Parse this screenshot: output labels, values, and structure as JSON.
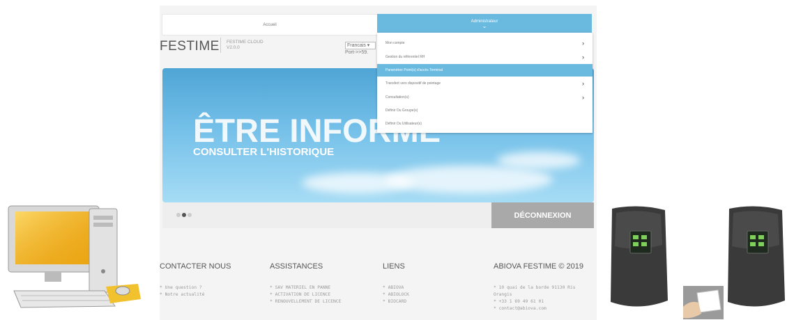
{
  "tabs": {
    "home": "Accueil",
    "admin": "Administrateur"
  },
  "header": {
    "brand": "FESTIME",
    "product_name": "FESTIME CLOUD",
    "product_version": "V2.0.0",
    "language": "Francais ▾",
    "port": "Port->>59."
  },
  "hero": {
    "title": "ÊTRE INFORMÉ",
    "subtitle": "CONSULTER L'HISTORIQUE",
    "slide_count": 3,
    "active_slide": 2
  },
  "logout_label": "DÉCONNEXION",
  "admin_menu": [
    {
      "label": "Mon compte",
      "has_submenu": true,
      "active": false
    },
    {
      "label": "Gestion du référentiel RH",
      "has_submenu": true,
      "active": false
    },
    {
      "label": "Paramétrer Point(s) d'accès Terminal",
      "has_submenu": false,
      "active": true
    },
    {
      "label": "Transfert vers dispositif de pointage",
      "has_submenu": true,
      "active": false
    },
    {
      "label": "Consultation(s)",
      "has_submenu": true,
      "active": false
    },
    {
      "label": "Définir Ou Groupe(s)",
      "has_submenu": false,
      "active": false
    },
    {
      "label": "Définir Ou Utilisateur(s)",
      "has_submenu": false,
      "active": false
    }
  ],
  "footer": {
    "contact": {
      "heading": "CONTACTER NOUS",
      "items": [
        "* Une question ?",
        "* Notre actualité"
      ]
    },
    "assist": {
      "heading": "ASSISTANCES",
      "items": [
        "* SAV MATERIEL EN PANNE",
        "* ACTIVATION DE LICENCE",
        "* RENOUVELLEMENT DE LICENCE"
      ]
    },
    "links": {
      "heading": "LIENS",
      "items": [
        "* ABIOVA",
        "* ABIOLOCK",
        "* BIOCARD"
      ]
    },
    "company": {
      "heading": "ABIOVA FESTIME © 2019",
      "items": [
        "* 10 quai de la borde 91130 Ris",
        "  Orangis",
        "* +33 1 69 49 61 01",
        "* contact@abiova.com"
      ]
    }
  },
  "colors": {
    "accent": "#6ab9df",
    "logout": "#a9a9a9",
    "sky_top": "#4fa5d5",
    "sky_bottom": "#a6dcf5"
  }
}
